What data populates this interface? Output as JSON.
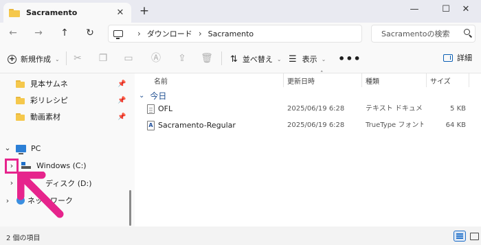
{
  "window": {
    "tab_title": "Sacramento",
    "tab_close": "✕",
    "new_tab": "+",
    "minimize": "—",
    "maximize": "☐",
    "close": "✕"
  },
  "nav": {
    "back": "←",
    "forward": "→",
    "up": "↑",
    "refresh": "↻",
    "breadcrumbs": [
      "ダウンロード",
      "Sacramento"
    ],
    "separator": "›",
    "search_placeholder": "Sacramentoの検索"
  },
  "commands": {
    "new_label": "新規作成",
    "sort_label": "並べ替え",
    "view_label": "表示",
    "more_label": "•••",
    "details_label": "詳細",
    "icons": [
      "cut-icon",
      "copy-icon",
      "paste-icon",
      "rename-icon",
      "share-icon",
      "delete-icon"
    ]
  },
  "sidebar": {
    "quick_access": [
      {
        "label": "見本サムネ"
      },
      {
        "label": "彩リレシピ"
      },
      {
        "label": "動画素材"
      }
    ],
    "pin_glyph": "📌",
    "pc_label": "PC",
    "drives": [
      {
        "label": "Windows (C:)"
      },
      {
        "label": "ディスク (D:)"
      }
    ],
    "network_label": "ネットワーク"
  },
  "filelist": {
    "columns": [
      "名前",
      "更新日時",
      "種類",
      "サイズ"
    ],
    "sort_caret": "˄",
    "group_label": "今日",
    "files": [
      {
        "name": "OFL",
        "date": "2025/06/19 6:28",
        "type": "テキスト ドキュメント",
        "size": "5 KB",
        "icon": "text-document-icon"
      },
      {
        "name": "Sacramento-Regular",
        "date": "2025/06/19 6:28",
        "type": "TrueType フォント フ...",
        "size": "64 KB",
        "icon": "font-file-icon"
      }
    ]
  },
  "status": {
    "item_count": "2 個の項目"
  },
  "colors": {
    "highlight": "#e6248c",
    "accent": "#1f6fc9",
    "folder": "#f5c84c"
  }
}
